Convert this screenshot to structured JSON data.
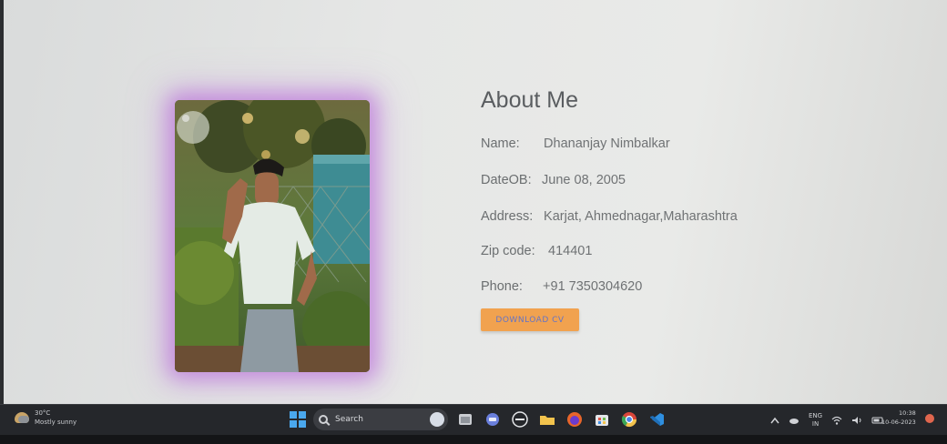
{
  "about": {
    "title": "About Me",
    "fields": [
      {
        "label": "Name:",
        "value": "Dhananjay Nimbalkar"
      },
      {
        "label": "DateOB:",
        "value": "June 08, 2005"
      },
      {
        "label": "Address:",
        "value": "Karjat, Ahmednagar,Maharashtra"
      },
      {
        "label": "Zip code:",
        "value": "414401"
      },
      {
        "label": "Phone:",
        "value": "+91 7350304620"
      }
    ],
    "download_label": "DOWNLOAD CV"
  },
  "taskbar": {
    "weather_temp": "30°C",
    "weather_desc": "Mostly sunny",
    "search_placeholder": "Search",
    "lang_line1": "ENG",
    "lang_line2": "IN",
    "time": "10:38",
    "date": "10-06-2023",
    "apps": [
      "file-explorer-icon",
      "chat-icon",
      "dell-icon",
      "folder-icon",
      "firefox-icon",
      "store-icon",
      "chrome-icon",
      "vscode-icon"
    ]
  },
  "colors": {
    "button_bg": "#f1a24f",
    "button_text": "#6474c6",
    "glow": "#b25cd6"
  }
}
